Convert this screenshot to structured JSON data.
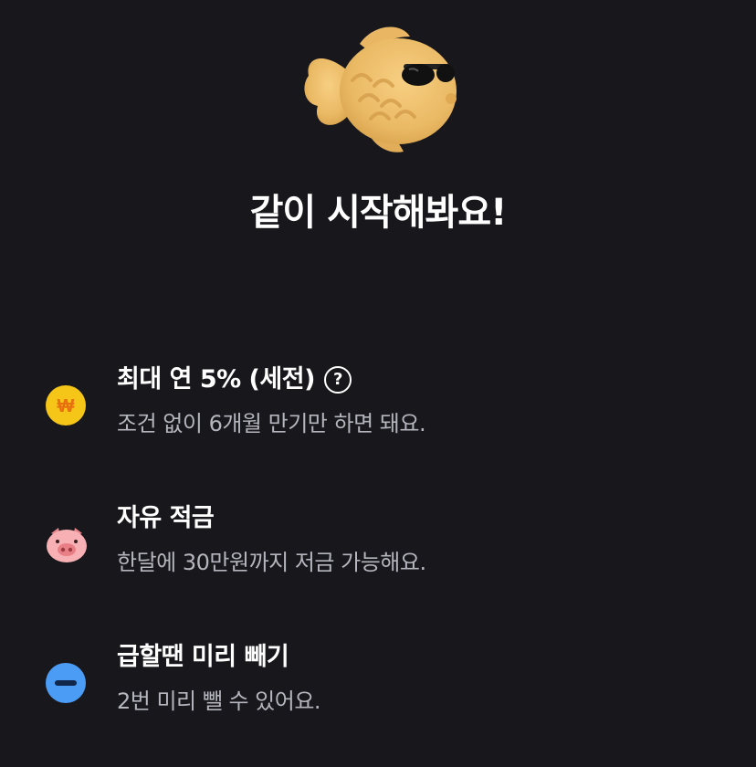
{
  "hero": {
    "icon": "fish-bun-with-sunglasses"
  },
  "title": "같이 시작해봐요!",
  "features": [
    {
      "icon": "won-coin-icon",
      "headline": "최대 연 5% (세전)",
      "help_label": "?",
      "description": "조건 없이 6개월 만기만 하면 돼요."
    },
    {
      "icon": "pig-icon",
      "headline": "자유 적금",
      "description": "한달에 30만원까지 저금 가능해요."
    },
    {
      "icon": "minus-circle-icon",
      "headline": "급할땐 미리 빼기",
      "description": "2번 미리 뺄 수 있어요."
    }
  ],
  "colors": {
    "background": "#17171c",
    "coin": "#f5c518",
    "pig": "#f7b1b5",
    "minus": "#4a9cf5",
    "fish": "#f2c46e",
    "description": "#b5b5bd"
  }
}
